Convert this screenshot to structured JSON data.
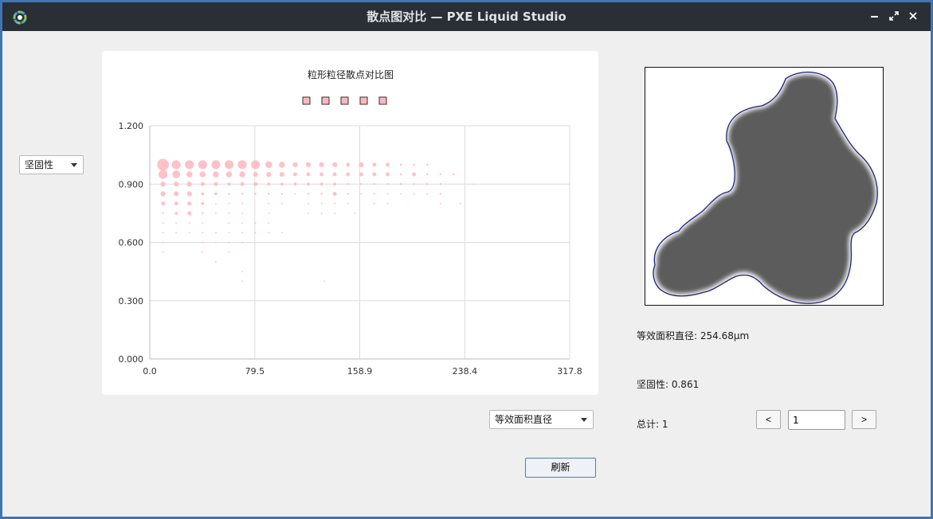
{
  "window": {
    "title": "散点图对比 — PXE Liquid Studio"
  },
  "left_combo": {
    "value": "坚固性"
  },
  "x_combo": {
    "value": "等效面积直径"
  },
  "chart_data": {
    "type": "scatter",
    "title": "粒形粒径散点对比图",
    "xlabel": "",
    "ylabel": "",
    "xlim": [
      0.0,
      317.8
    ],
    "ylim": [
      0.0,
      1.2
    ],
    "x_ticks": [
      "0.0",
      "79.5",
      "158.9",
      "238.4",
      "317.8"
    ],
    "y_ticks": [
      "0.000",
      "0.300",
      "0.600",
      "0.900",
      "1.200"
    ],
    "grid": true,
    "legend_markers": 5,
    "marker_color": "#ffb6bf",
    "points": [
      {
        "x": 10,
        "y": 1.0,
        "r": 12
      },
      {
        "x": 20,
        "y": 1.0,
        "r": 9
      },
      {
        "x": 30,
        "y": 1.0,
        "r": 9
      },
      {
        "x": 40,
        "y": 1.0,
        "r": 9
      },
      {
        "x": 50,
        "y": 1.0,
        "r": 9
      },
      {
        "x": 60,
        "y": 1.0,
        "r": 9
      },
      {
        "x": 70,
        "y": 1.0,
        "r": 9
      },
      {
        "x": 80,
        "y": 1.0,
        "r": 9
      },
      {
        "x": 90,
        "y": 1.0,
        "r": 7
      },
      {
        "x": 100,
        "y": 1.0,
        "r": 6
      },
      {
        "x": 110,
        "y": 1.0,
        "r": 5
      },
      {
        "x": 120,
        "y": 1.0,
        "r": 5
      },
      {
        "x": 130,
        "y": 1.0,
        "r": 5
      },
      {
        "x": 140,
        "y": 1.0,
        "r": 5
      },
      {
        "x": 150,
        "y": 1.0,
        "r": 4
      },
      {
        "x": 160,
        "y": 1.0,
        "r": 5
      },
      {
        "x": 170,
        "y": 1.0,
        "r": 4
      },
      {
        "x": 180,
        "y": 1.0,
        "r": 4
      },
      {
        "x": 190,
        "y": 1.0,
        "r": 2
      },
      {
        "x": 200,
        "y": 1.0,
        "r": 2
      },
      {
        "x": 210,
        "y": 1.0,
        "r": 2
      },
      {
        "x": 10,
        "y": 0.95,
        "r": 9
      },
      {
        "x": 20,
        "y": 0.95,
        "r": 8
      },
      {
        "x": 30,
        "y": 0.95,
        "r": 6
      },
      {
        "x": 40,
        "y": 0.95,
        "r": 6
      },
      {
        "x": 50,
        "y": 0.95,
        "r": 6
      },
      {
        "x": 60,
        "y": 0.95,
        "r": 6
      },
      {
        "x": 70,
        "y": 0.95,
        "r": 6
      },
      {
        "x": 80,
        "y": 0.95,
        "r": 5
      },
      {
        "x": 90,
        "y": 0.95,
        "r": 5
      },
      {
        "x": 100,
        "y": 0.95,
        "r": 5
      },
      {
        "x": 110,
        "y": 0.95,
        "r": 4
      },
      {
        "x": 120,
        "y": 0.95,
        "r": 4
      },
      {
        "x": 130,
        "y": 0.95,
        "r": 4
      },
      {
        "x": 140,
        "y": 0.95,
        "r": 4
      },
      {
        "x": 150,
        "y": 0.95,
        "r": 4
      },
      {
        "x": 160,
        "y": 0.95,
        "r": 4
      },
      {
        "x": 170,
        "y": 0.95,
        "r": 4
      },
      {
        "x": 180,
        "y": 0.95,
        "r": 4
      },
      {
        "x": 190,
        "y": 0.95,
        "r": 2
      },
      {
        "x": 200,
        "y": 0.95,
        "r": 4
      },
      {
        "x": 210,
        "y": 0.95,
        "r": 2
      },
      {
        "x": 220,
        "y": 0.95,
        "r": 2
      },
      {
        "x": 230,
        "y": 0.95,
        "r": 2
      },
      {
        "x": 10,
        "y": 0.9,
        "r": 5
      },
      {
        "x": 20,
        "y": 0.9,
        "r": 5
      },
      {
        "x": 30,
        "y": 0.9,
        "r": 5
      },
      {
        "x": 40,
        "y": 0.9,
        "r": 4
      },
      {
        "x": 50,
        "y": 0.9,
        "r": 4
      },
      {
        "x": 60,
        "y": 0.9,
        "r": 3
      },
      {
        "x": 70,
        "y": 0.9,
        "r": 4
      },
      {
        "x": 80,
        "y": 0.9,
        "r": 4
      },
      {
        "x": 90,
        "y": 0.9,
        "r": 3
      },
      {
        "x": 100,
        "y": 0.9,
        "r": 3
      },
      {
        "x": 110,
        "y": 0.9,
        "r": 3
      },
      {
        "x": 120,
        "y": 0.9,
        "r": 3
      },
      {
        "x": 130,
        "y": 0.9,
        "r": 3
      },
      {
        "x": 140,
        "y": 0.9,
        "r": 3
      },
      {
        "x": 150,
        "y": 0.9,
        "r": 2
      },
      {
        "x": 160,
        "y": 0.9,
        "r": 2
      },
      {
        "x": 170,
        "y": 0.9,
        "r": 2
      },
      {
        "x": 180,
        "y": 0.9,
        "r": 2
      },
      {
        "x": 190,
        "y": 0.9,
        "r": 2
      },
      {
        "x": 200,
        "y": 0.9,
        "r": 2
      },
      {
        "x": 210,
        "y": 0.9,
        "r": 2
      },
      {
        "x": 220,
        "y": 0.9,
        "r": 2
      },
      {
        "x": 245,
        "y": 0.9,
        "r": 1.5
      },
      {
        "x": 10,
        "y": 0.85,
        "r": 5
      },
      {
        "x": 20,
        "y": 0.85,
        "r": 5
      },
      {
        "x": 30,
        "y": 0.85,
        "r": 5
      },
      {
        "x": 40,
        "y": 0.85,
        "r": 3
      },
      {
        "x": 50,
        "y": 0.85,
        "r": 3
      },
      {
        "x": 60,
        "y": 0.85,
        "r": 2
      },
      {
        "x": 70,
        "y": 0.85,
        "r": 2
      },
      {
        "x": 80,
        "y": 0.85,
        "r": 2
      },
      {
        "x": 90,
        "y": 0.85,
        "r": 2
      },
      {
        "x": 100,
        "y": 0.85,
        "r": 2
      },
      {
        "x": 110,
        "y": 0.85,
        "r": 1.5
      },
      {
        "x": 120,
        "y": 0.85,
        "r": 2
      },
      {
        "x": 130,
        "y": 0.85,
        "r": 2
      },
      {
        "x": 140,
        "y": 0.85,
        "r": 4
      },
      {
        "x": 150,
        "y": 0.85,
        "r": 2
      },
      {
        "x": 160,
        "y": 0.85,
        "r": 1.5
      },
      {
        "x": 170,
        "y": 0.85,
        "r": 1.5
      },
      {
        "x": 180,
        "y": 0.85,
        "r": 1.5
      },
      {
        "x": 190,
        "y": 0.85,
        "r": 1.5
      },
      {
        "x": 200,
        "y": 0.85,
        "r": 1.5
      },
      {
        "x": 210,
        "y": 0.85,
        "r": 1.5
      },
      {
        "x": 220,
        "y": 0.85,
        "r": 2
      },
      {
        "x": 10,
        "y": 0.8,
        "r": 4
      },
      {
        "x": 20,
        "y": 0.8,
        "r": 4
      },
      {
        "x": 30,
        "y": 0.8,
        "r": 4
      },
      {
        "x": 40,
        "y": 0.8,
        "r": 3
      },
      {
        "x": 50,
        "y": 0.8,
        "r": 1.5
      },
      {
        "x": 60,
        "y": 0.8,
        "r": 1.5
      },
      {
        "x": 70,
        "y": 0.8,
        "r": 1.5
      },
      {
        "x": 90,
        "y": 0.8,
        "r": 1.5
      },
      {
        "x": 100,
        "y": 0.8,
        "r": 1.5
      },
      {
        "x": 120,
        "y": 0.8,
        "r": 1.5
      },
      {
        "x": 130,
        "y": 0.8,
        "r": 1.5
      },
      {
        "x": 140,
        "y": 0.8,
        "r": 1.5
      },
      {
        "x": 150,
        "y": 0.8,
        "r": 1.5
      },
      {
        "x": 170,
        "y": 0.8,
        "r": 1.5
      },
      {
        "x": 180,
        "y": 0.8,
        "r": 1.5
      },
      {
        "x": 220,
        "y": 0.8,
        "r": 1.5
      },
      {
        "x": 235,
        "y": 0.8,
        "r": 1.5
      },
      {
        "x": 10,
        "y": 0.75,
        "r": 2
      },
      {
        "x": 20,
        "y": 0.75,
        "r": 3
      },
      {
        "x": 30,
        "y": 0.75,
        "r": 4
      },
      {
        "x": 40,
        "y": 0.75,
        "r": 2
      },
      {
        "x": 50,
        "y": 0.75,
        "r": 1.5
      },
      {
        "x": 60,
        "y": 0.75,
        "r": 1.5
      },
      {
        "x": 70,
        "y": 0.75,
        "r": 1.5
      },
      {
        "x": 90,
        "y": 0.75,
        "r": 1.5
      },
      {
        "x": 120,
        "y": 0.75,
        "r": 1.5
      },
      {
        "x": 130,
        "y": 0.75,
        "r": 1.5
      },
      {
        "x": 140,
        "y": 0.75,
        "r": 1.5
      },
      {
        "x": 155,
        "y": 0.75,
        "r": 1.5
      },
      {
        "x": 10,
        "y": 0.7,
        "r": 1.5
      },
      {
        "x": 20,
        "y": 0.7,
        "r": 1.5
      },
      {
        "x": 30,
        "y": 0.7,
        "r": 1.5
      },
      {
        "x": 40,
        "y": 0.7,
        "r": 1.5
      },
      {
        "x": 60,
        "y": 0.7,
        "r": 1.5
      },
      {
        "x": 70,
        "y": 0.7,
        "r": 1.5
      },
      {
        "x": 80,
        "y": 0.7,
        "r": 1.5
      },
      {
        "x": 90,
        "y": 0.7,
        "r": 1.5
      },
      {
        "x": 10,
        "y": 0.65,
        "r": 1.5
      },
      {
        "x": 20,
        "y": 0.65,
        "r": 1.5
      },
      {
        "x": 30,
        "y": 0.65,
        "r": 1.5
      },
      {
        "x": 40,
        "y": 0.65,
        "r": 1.5
      },
      {
        "x": 50,
        "y": 0.65,
        "r": 1.5
      },
      {
        "x": 60,
        "y": 0.65,
        "r": 1.5
      },
      {
        "x": 70,
        "y": 0.65,
        "r": 1.5
      },
      {
        "x": 80,
        "y": 0.65,
        "r": 1.5
      },
      {
        "x": 90,
        "y": 0.65,
        "r": 1.5
      },
      {
        "x": 100,
        "y": 0.65,
        "r": 1.5
      },
      {
        "x": 10,
        "y": 0.6,
        "r": 1.5
      },
      {
        "x": 40,
        "y": 0.6,
        "r": 1.5
      },
      {
        "x": 50,
        "y": 0.6,
        "r": 1.5
      },
      {
        "x": 60,
        "y": 0.6,
        "r": 1.5
      },
      {
        "x": 70,
        "y": 0.6,
        "r": 1.5
      },
      {
        "x": 10,
        "y": 0.55,
        "r": 1.5
      },
      {
        "x": 40,
        "y": 0.55,
        "r": 1.5
      },
      {
        "x": 60,
        "y": 0.55,
        "r": 1.5
      },
      {
        "x": 50,
        "y": 0.5,
        "r": 1.5
      },
      {
        "x": 70,
        "y": 0.45,
        "r": 1.5
      },
      {
        "x": 70,
        "y": 0.4,
        "r": 1.5
      },
      {
        "x": 132,
        "y": 0.4,
        "r": 1.5
      }
    ]
  },
  "info": {
    "diameter": "等效面积直径: 254.68μm",
    "solidity": "坚固性: 0.861",
    "total": "总计:  1"
  },
  "pager": {
    "prev": "<",
    "next": ">",
    "page": "1"
  },
  "refresh_label": "刷新"
}
